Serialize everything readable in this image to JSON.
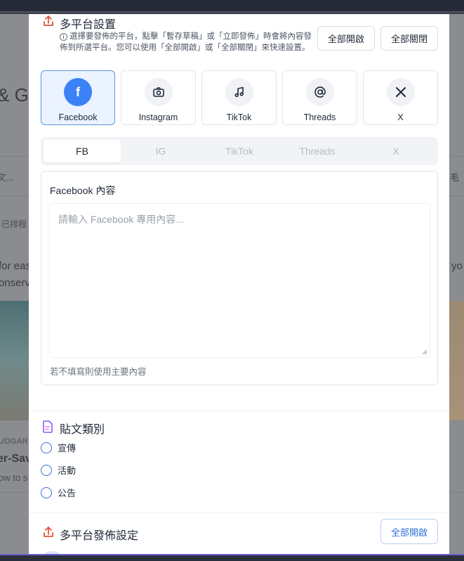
{
  "background": {
    "title_fragment": "& G",
    "search_fragment": "文...",
    "scheduled_fragment": "已排程",
    "line1_fragment": "for eas",
    "line2_fragment": "onserv",
    "right_fragment": "yo",
    "right_search_fragment": "毛",
    "category_fragment": "UDGARD",
    "heading_fragment": "er-Sav",
    "sub_fragment": "ow to s"
  },
  "multi_platform": {
    "title": "多平台設置",
    "hint": "選擇要發佈的平台，點擊「暫存草稿」或「立即發佈」時會將內容發佈到所選平台。您可以使用「全部開啟」或「全部關閉」來快速設置。",
    "enable_all": "全部開啟",
    "disable_all": "全部關閉",
    "platforms": [
      {
        "name": "Facebook",
        "icon": "facebook-icon",
        "selected": true
      },
      {
        "name": "Instagram",
        "icon": "camera-icon",
        "selected": false
      },
      {
        "name": "TikTok",
        "icon": "music-note-icon",
        "selected": false
      },
      {
        "name": "Threads",
        "icon": "at-sign-icon",
        "selected": false
      },
      {
        "name": "X",
        "icon": "x-logo-icon",
        "selected": false
      }
    ]
  },
  "tabs": [
    {
      "label": "FB",
      "active": true
    },
    {
      "label": "IG",
      "active": false
    },
    {
      "label": "TikTok",
      "active": false
    },
    {
      "label": "Threads",
      "active": false
    },
    {
      "label": "X",
      "active": false
    }
  ],
  "content": {
    "label": "Facebook 內容",
    "placeholder": "請輸入 Facebook 專用內容...",
    "helper": "若不填寫則使用主要內容"
  },
  "post_category": {
    "title": "貼文類別",
    "options": [
      "宣傳",
      "活動",
      "公告"
    ]
  },
  "publish_settings": {
    "title": "多平台發佈設定",
    "enable_all": "全部開啟"
  },
  "colors": {
    "accent": "#3b82f6",
    "selected_card_bg": "#eaf3ff",
    "upload_icon": "#e0533d",
    "category_icon": "#8b5cf6"
  }
}
